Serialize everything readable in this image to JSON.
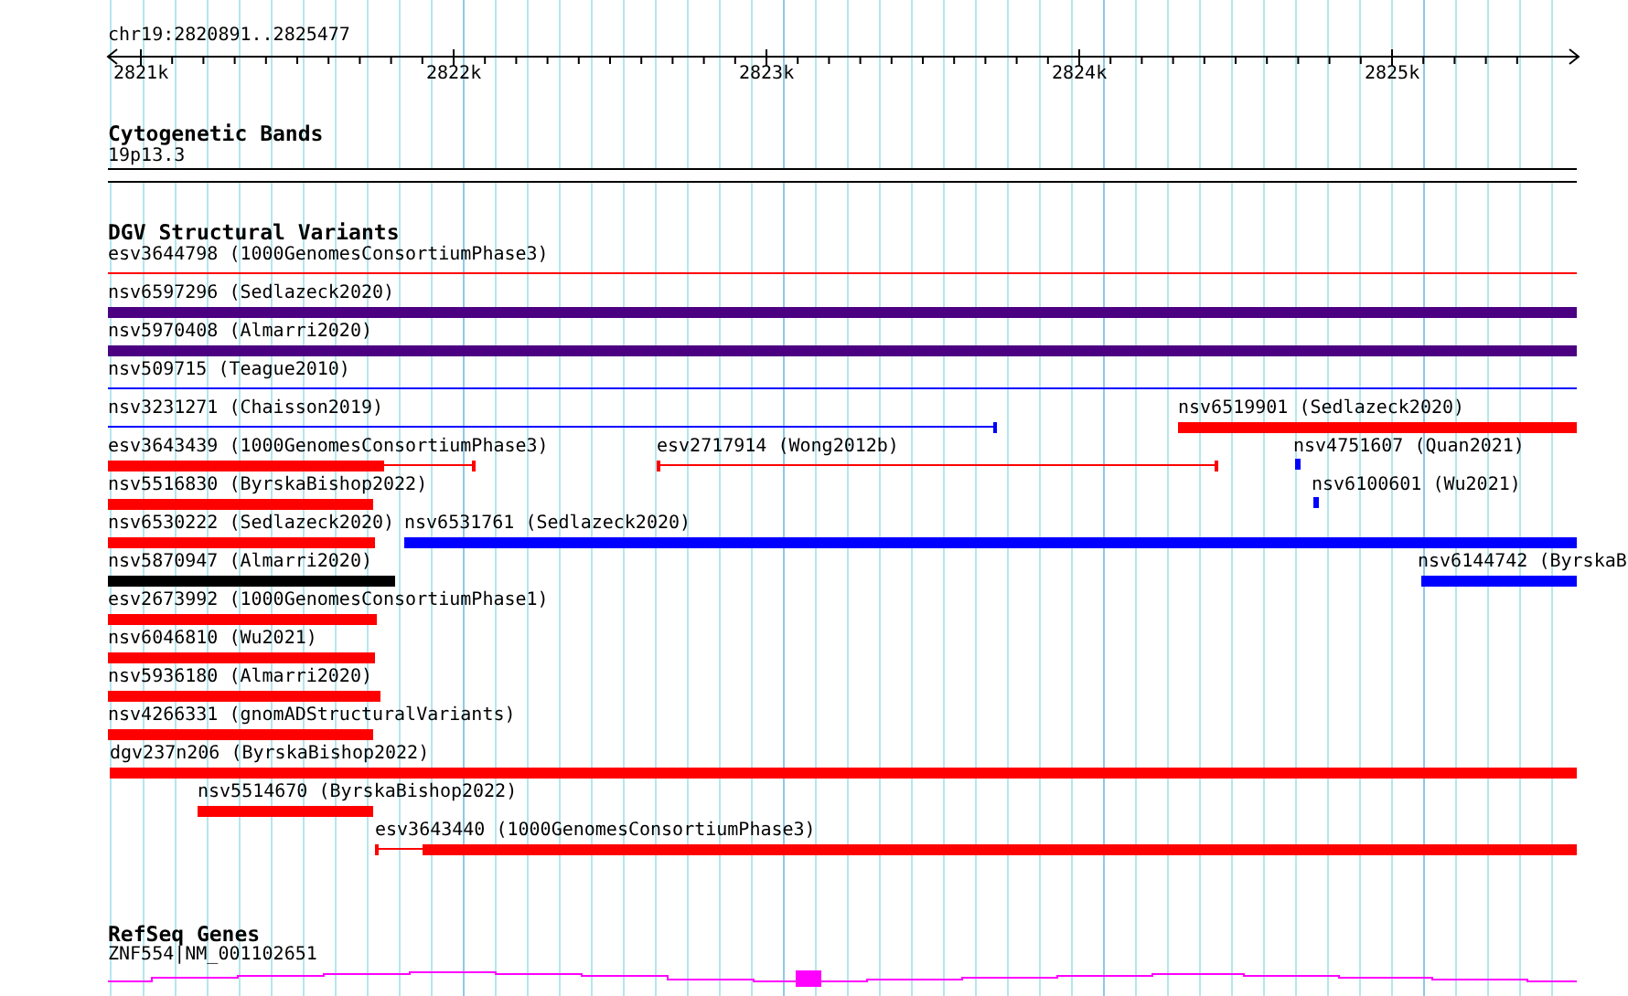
{
  "ruler": {
    "position": "chr19:2820891..2825477",
    "ticks": [
      "2821k",
      "2822k",
      "2823k",
      "2824k",
      "2825k"
    ]
  },
  "cytogenetic_bands": {
    "title": "Cytogenetic Bands",
    "band": "19p13.3"
  },
  "dgv_track": {
    "title": "DGV Structural Variants",
    "rows": [
      {
        "features": [
          {
            "label": "esv3644798 (1000GenomesConsortiumPhase3)",
            "color": "#ff0000",
            "kind": "line"
          }
        ]
      },
      {
        "features": [
          {
            "label": "nsv6597296 (Sedlazeck2020)",
            "color": "#4b0082",
            "kind": "bar"
          }
        ]
      },
      {
        "features": [
          {
            "label": "nsv5970408 (Almarri2020)",
            "color": "#4b0082",
            "kind": "bar"
          }
        ]
      },
      {
        "features": [
          {
            "label": "nsv509715 (Teague2010)",
            "color": "#0000ff",
            "kind": "line"
          }
        ]
      },
      {
        "features": [
          {
            "label": "nsv3231271 (Chaisson2019)",
            "color": "#0000ff",
            "kind": "line"
          },
          {
            "label": "nsv6519901 (Sedlazeck2020)",
            "color": "#ff0000",
            "kind": "bar"
          }
        ]
      },
      {
        "features": [
          {
            "label": "esv3643439 (1000GenomesConsortiumPhase3)",
            "color": "#ff0000",
            "kind": "bar"
          },
          {
            "label": "esv2717914 (Wong2012b)",
            "color": "#ff0000",
            "kind": "line"
          },
          {
            "label": "nsv4751607 (Quan2021)",
            "color": "#0000ff",
            "kind": "mark"
          }
        ]
      },
      {
        "features": [
          {
            "label": "nsv5516830 (ByrskaBishop2022)",
            "color": "#ff0000",
            "kind": "bar"
          },
          {
            "label": "nsv6100601 (Wu2021)",
            "color": "#0000ff",
            "kind": "mark"
          }
        ]
      },
      {
        "features": [
          {
            "label": "nsv6530222 (Sedlazeck2020)",
            "color": "#ff0000",
            "kind": "bar"
          },
          {
            "label": "nsv6531761 (Sedlazeck2020)",
            "color": "#0000ff",
            "kind": "bar"
          }
        ]
      },
      {
        "features": [
          {
            "label": "nsv5870947 (Almarri2020)",
            "color": "#000000",
            "kind": "bar"
          },
          {
            "label": "nsv6144742 (ByrskaB",
            "color": "#0000ff",
            "kind": "bar"
          }
        ]
      },
      {
        "features": [
          {
            "label": "esv2673992 (1000GenomesConsortiumPhase1)",
            "color": "#ff0000",
            "kind": "bar"
          }
        ]
      },
      {
        "features": [
          {
            "label": "nsv6046810 (Wu2021)",
            "color": "#ff0000",
            "kind": "bar"
          }
        ]
      },
      {
        "features": [
          {
            "label": "nsv5936180 (Almarri2020)",
            "color": "#ff0000",
            "kind": "bar"
          }
        ]
      },
      {
        "features": [
          {
            "label": "nsv4266331 (gnomADStructuralVariants)",
            "color": "#ff0000",
            "kind": "bar"
          }
        ]
      },
      {
        "features": [
          {
            "label": "dgv237n206 (ByrskaBishop2022)",
            "color": "#ff0000",
            "kind": "bar"
          }
        ]
      },
      {
        "features": [
          {
            "label": "nsv5514670 (ByrskaBishop2022)",
            "color": "#ff0000",
            "kind": "bar"
          }
        ]
      },
      {
        "features": [
          {
            "label": "esv3643440 (1000GenomesConsortiumPhase3)",
            "color": "#ff0000",
            "kind": "bar"
          }
        ]
      }
    ]
  },
  "refseq_track": {
    "title": "RefSeq Genes",
    "gene": "ZNF554|NM_001102651"
  }
}
